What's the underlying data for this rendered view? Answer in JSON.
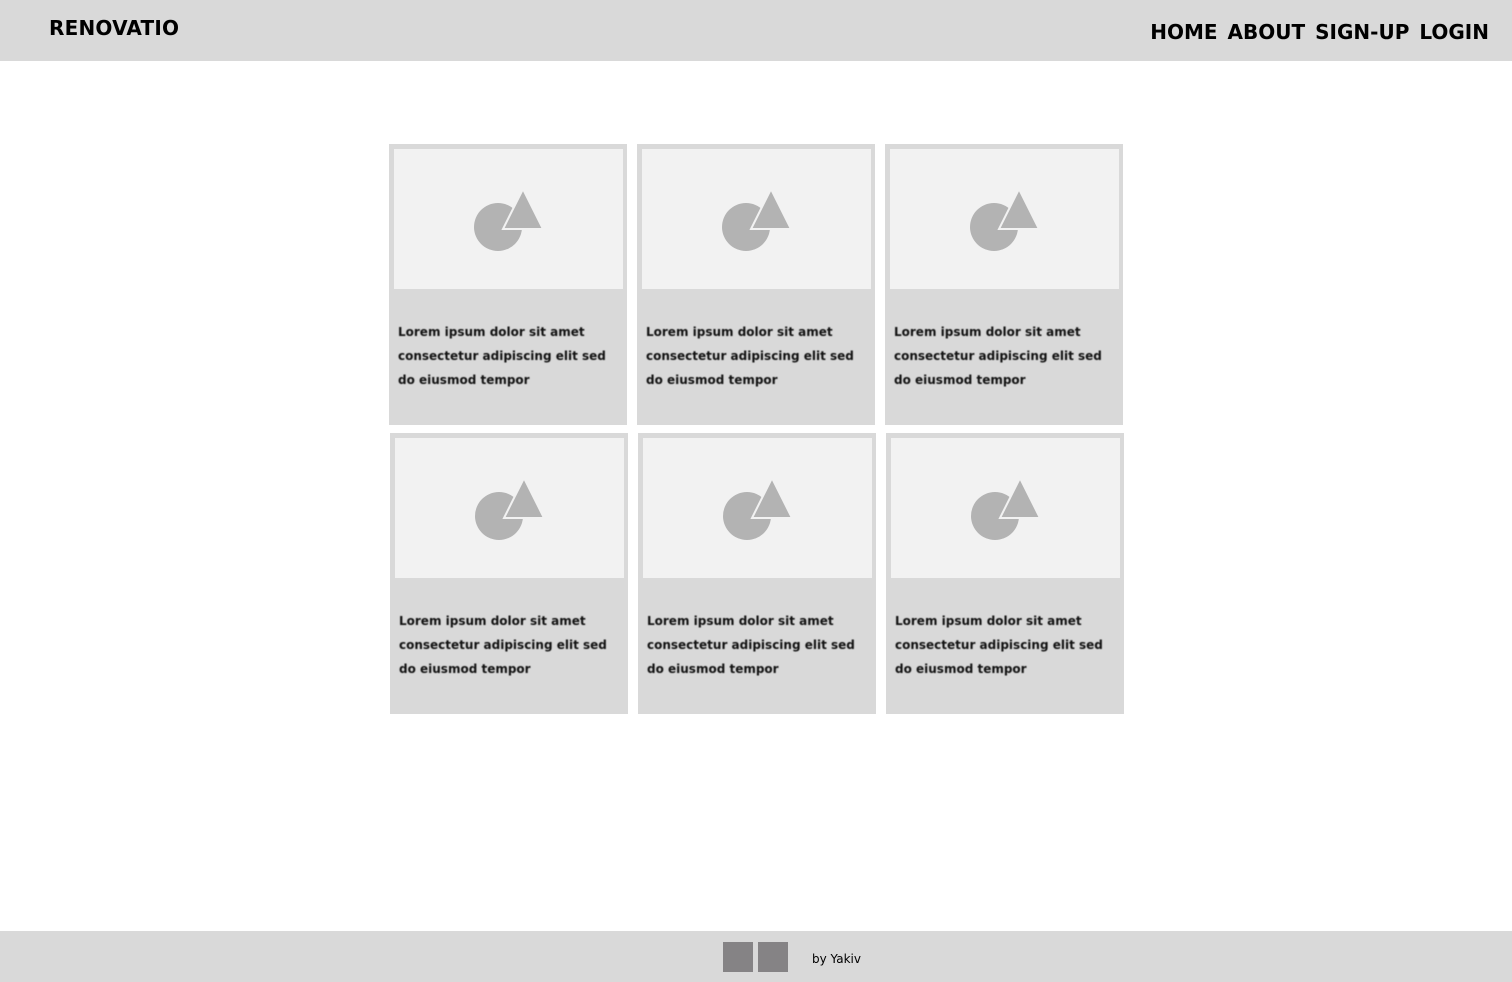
{
  "header": {
    "brand": "RENOVATIO",
    "nav": [
      "HOME",
      "ABOUT",
      "SIGN-UP",
      "LOGIN"
    ]
  },
  "cards": [
    {
      "image_icon": "image-placeholder-icon",
      "text": "Lorem ipsum dolor sit amet consectetur adipiscing elit sed do eiusmod tempor"
    },
    {
      "image_icon": "image-placeholder-icon",
      "text": "Lorem ipsum dolor sit amet consectetur adipiscing elit sed do eiusmod tempor"
    },
    {
      "image_icon": "image-placeholder-icon",
      "text": "Lorem ipsum dolor sit amet consectetur adipiscing elit sed do eiusmod tempor"
    },
    {
      "image_icon": "image-placeholder-icon",
      "text": "Lorem ipsum dolor sit amet consectetur adipiscing elit sed do eiusmod tempor"
    },
    {
      "image_icon": "image-placeholder-icon",
      "text": "Lorem ipsum dolor sit amet consectetur adipiscing elit sed do eiusmod tempor"
    },
    {
      "image_icon": "image-placeholder-icon",
      "text": "Lorem ipsum dolor sit amet consectetur adipiscing elit sed do eiusmod tempor"
    }
  ],
  "footer": {
    "social_icons": [
      "social-icon-1",
      "social-icon-2"
    ],
    "credit": "by Yakiv"
  },
  "colors": {
    "bar": "#d9d9d9",
    "image_bg": "#f2f2f2",
    "placeholder": "#b3b3b3",
    "social": "#858385"
  }
}
